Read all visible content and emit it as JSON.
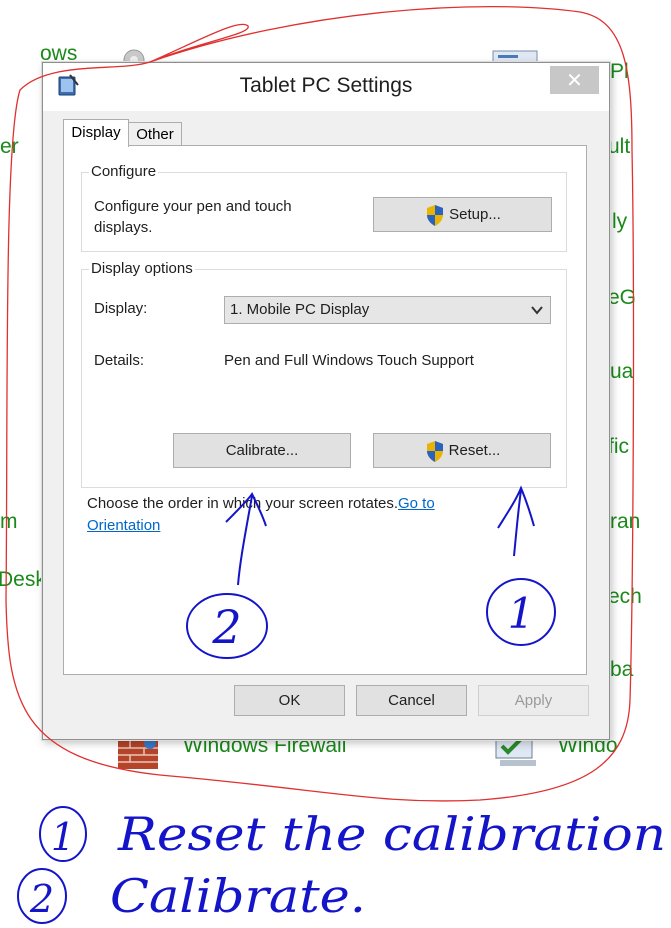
{
  "background_items": [
    {
      "id": "ows",
      "label": "ows"
    },
    {
      "id": "er",
      "label": "er"
    },
    {
      "id": "m",
      "label": "m"
    },
    {
      "id": "desk",
      "label": "Desk"
    },
    {
      "id": "firewall",
      "label": "Windows Firewall"
    },
    {
      "id": "windo",
      "label": "Windo"
    },
    {
      "id": "pl",
      "label": "Pl"
    },
    {
      "id": "ult",
      "label": "ult"
    },
    {
      "id": "ly",
      "label": "ly"
    },
    {
      "id": "eg",
      "label": "eG"
    },
    {
      "id": "ua",
      "label": "ua"
    },
    {
      "id": "fic",
      "label": "fic"
    },
    {
      "id": "ran",
      "label": "ran"
    },
    {
      "id": "ech",
      "label": "ech"
    },
    {
      "id": "ba",
      "label": "ba"
    }
  ],
  "dialog": {
    "title": "Tablet PC Settings",
    "close_glyph": "✕",
    "tabs": [
      {
        "label": "Display"
      },
      {
        "label": "Other"
      }
    ],
    "configure": {
      "label": "Configure",
      "description": "Configure your pen and touch displays.",
      "setup_button": "Setup..."
    },
    "display_options": {
      "label": "Display options",
      "display_label": "Display:",
      "display_value": "1. Mobile PC Display",
      "details_label": "Details:",
      "details_value": "Pen and Full Windows Touch Support",
      "calibrate_button": "Calibrate...",
      "reset_button": "Reset..."
    },
    "orientation_text": "Choose the order in which your screen rotates.",
    "orientation_link": "Go to Orientation",
    "buttons": {
      "ok": "OK",
      "cancel": "Cancel",
      "apply": "Apply"
    }
  },
  "annotations": {
    "marker_calibrate": "2",
    "marker_reset": "1",
    "note_1_number": "1",
    "note_1_text": "Reset the calibration",
    "note_2_number": "2",
    "note_2_text": "Calibrate."
  },
  "colors": {
    "link": "#0066cc",
    "ink": "#1414c8",
    "outline": "#e03030",
    "background_text": "#1a8a1a"
  }
}
